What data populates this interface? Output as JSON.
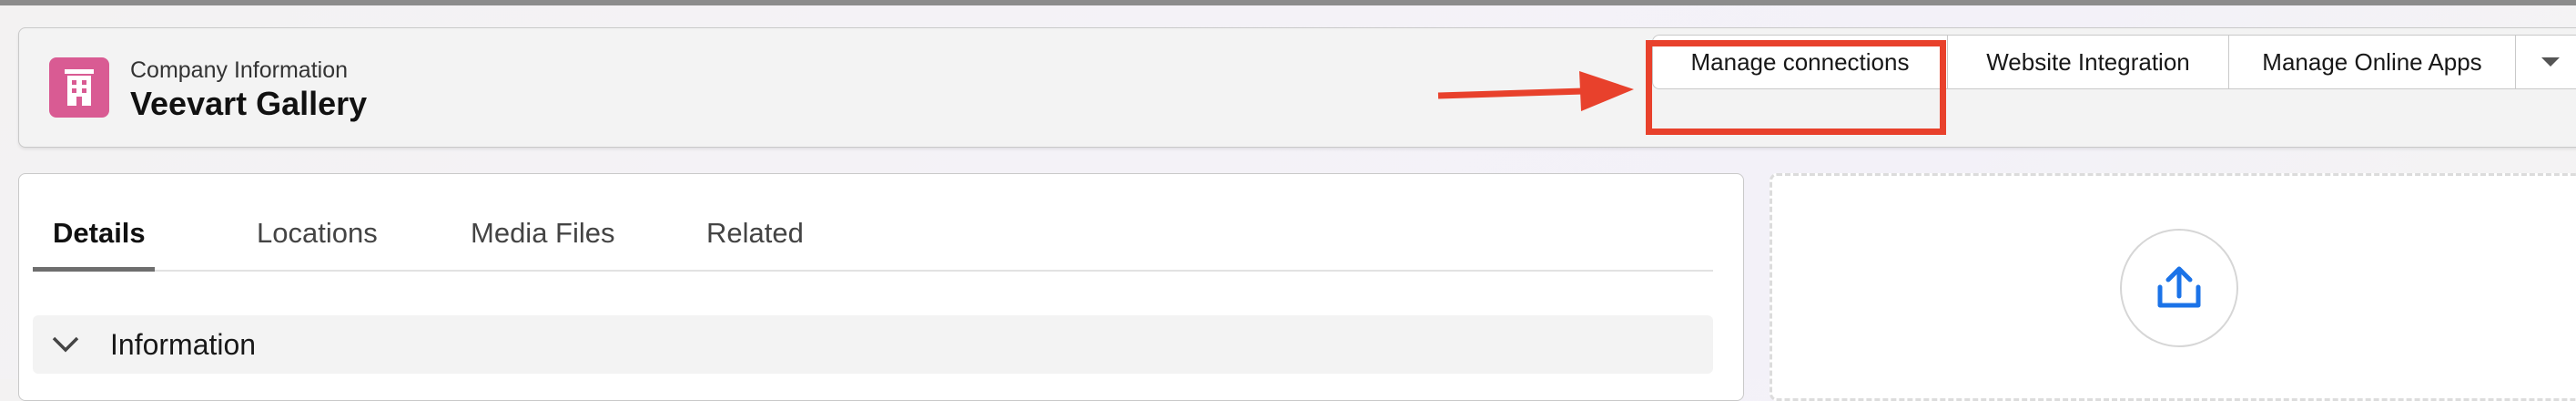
{
  "header": {
    "record_type": "Company Information",
    "record_name": "Veevart Gallery",
    "icon": "building-icon",
    "icon_color": "#d95b93"
  },
  "actions": {
    "manage_connections": "Manage connections",
    "website_integration": "Website Integration",
    "manage_online_apps": "Manage Online Apps",
    "more_icon": "chevron-down-icon"
  },
  "annotation": {
    "highlight_color": "#e8412c"
  },
  "tabs": [
    {
      "label": "Details",
      "active": true
    },
    {
      "label": "Locations",
      "active": false
    },
    {
      "label": "Media Files",
      "active": false
    },
    {
      "label": "Related",
      "active": false
    }
  ],
  "section": {
    "title": "Information",
    "icon": "chevron-down-icon"
  },
  "upload": {
    "icon": "upload-icon",
    "icon_color": "#1b73e8"
  }
}
